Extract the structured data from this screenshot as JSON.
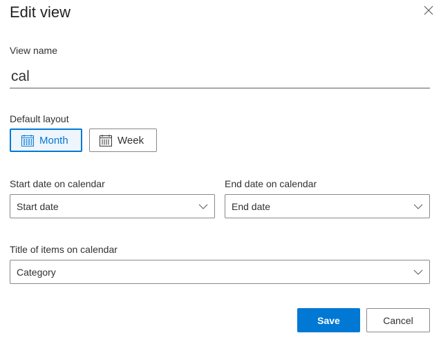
{
  "dialog": {
    "title": "Edit view",
    "close_icon": "close-icon"
  },
  "view_name": {
    "label": "View name",
    "value": "cal"
  },
  "default_layout": {
    "label": "Default layout",
    "options": [
      {
        "label": "Month",
        "icon": "calendar-month-icon",
        "selected": true
      },
      {
        "label": "Week",
        "icon": "calendar-week-icon",
        "selected": false
      }
    ]
  },
  "start_date": {
    "label": "Start date on calendar",
    "value": "Start date"
  },
  "end_date": {
    "label": "End date on calendar",
    "value": "End date"
  },
  "title_items": {
    "label": "Title of items on calendar",
    "value": "Category"
  },
  "actions": {
    "save_label": "Save",
    "cancel_label": "Cancel"
  },
  "colors": {
    "accent": "#0078d4",
    "text": "#323130",
    "border": "#8a8886"
  }
}
